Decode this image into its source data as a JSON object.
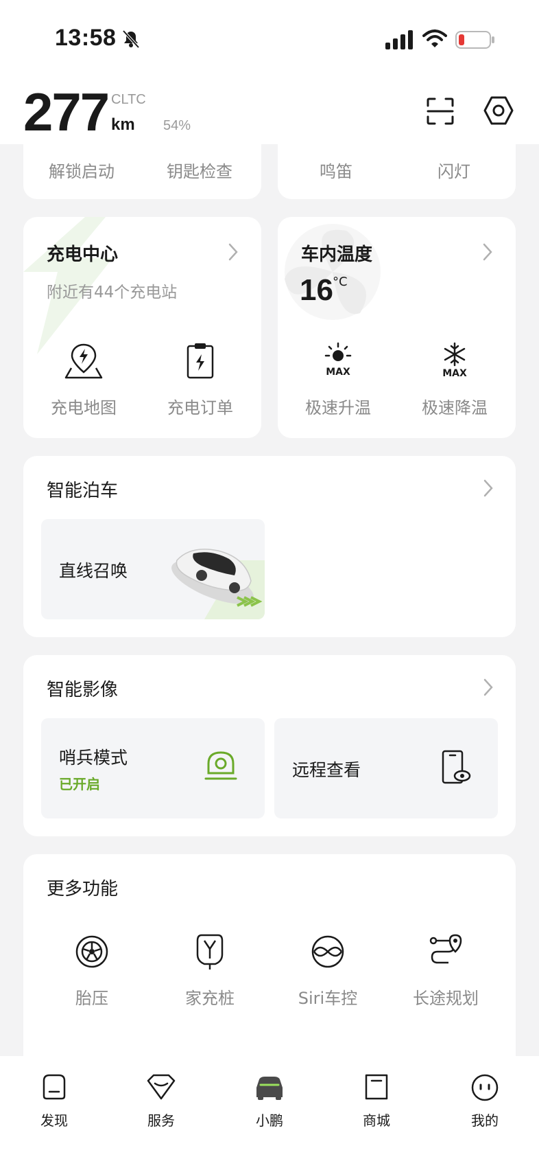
{
  "status_bar": {
    "time": "13:58"
  },
  "header": {
    "range": "277",
    "standard": "CLTC",
    "unit": "km",
    "battery_percent": "54%"
  },
  "quick_actions": {
    "left": [
      "解锁启动",
      "钥匙检查"
    ],
    "right": [
      "鸣笛",
      "闪灯"
    ]
  },
  "charging": {
    "title": "充电中心",
    "subtitle": "附近有44个充电站",
    "items": [
      "充电地图",
      "充电订单"
    ]
  },
  "cabin_temp": {
    "title": "车内温度",
    "value": "16",
    "unit": "°C",
    "items": [
      "极速升温",
      "极速降温"
    ],
    "icon_text": "MAX"
  },
  "smart_parking": {
    "title": "智能泊车",
    "tile_label": "直线召唤"
  },
  "smart_imaging": {
    "title": "智能影像",
    "sentry": {
      "label": "哨兵模式",
      "status": "已开启"
    },
    "remote": {
      "label": "远程查看"
    }
  },
  "more_features": {
    "title": "更多功能",
    "items": [
      "胎压",
      "家充桩",
      "Siri车控",
      "长途规划"
    ]
  },
  "bottom_nav": {
    "items": [
      "发现",
      "服务",
      "小鹏",
      "商城",
      "我的"
    ]
  },
  "colors": {
    "accent_green": "#6aaa2a",
    "text_gray": "#8a8a8a",
    "battery_red": "#e53935"
  }
}
